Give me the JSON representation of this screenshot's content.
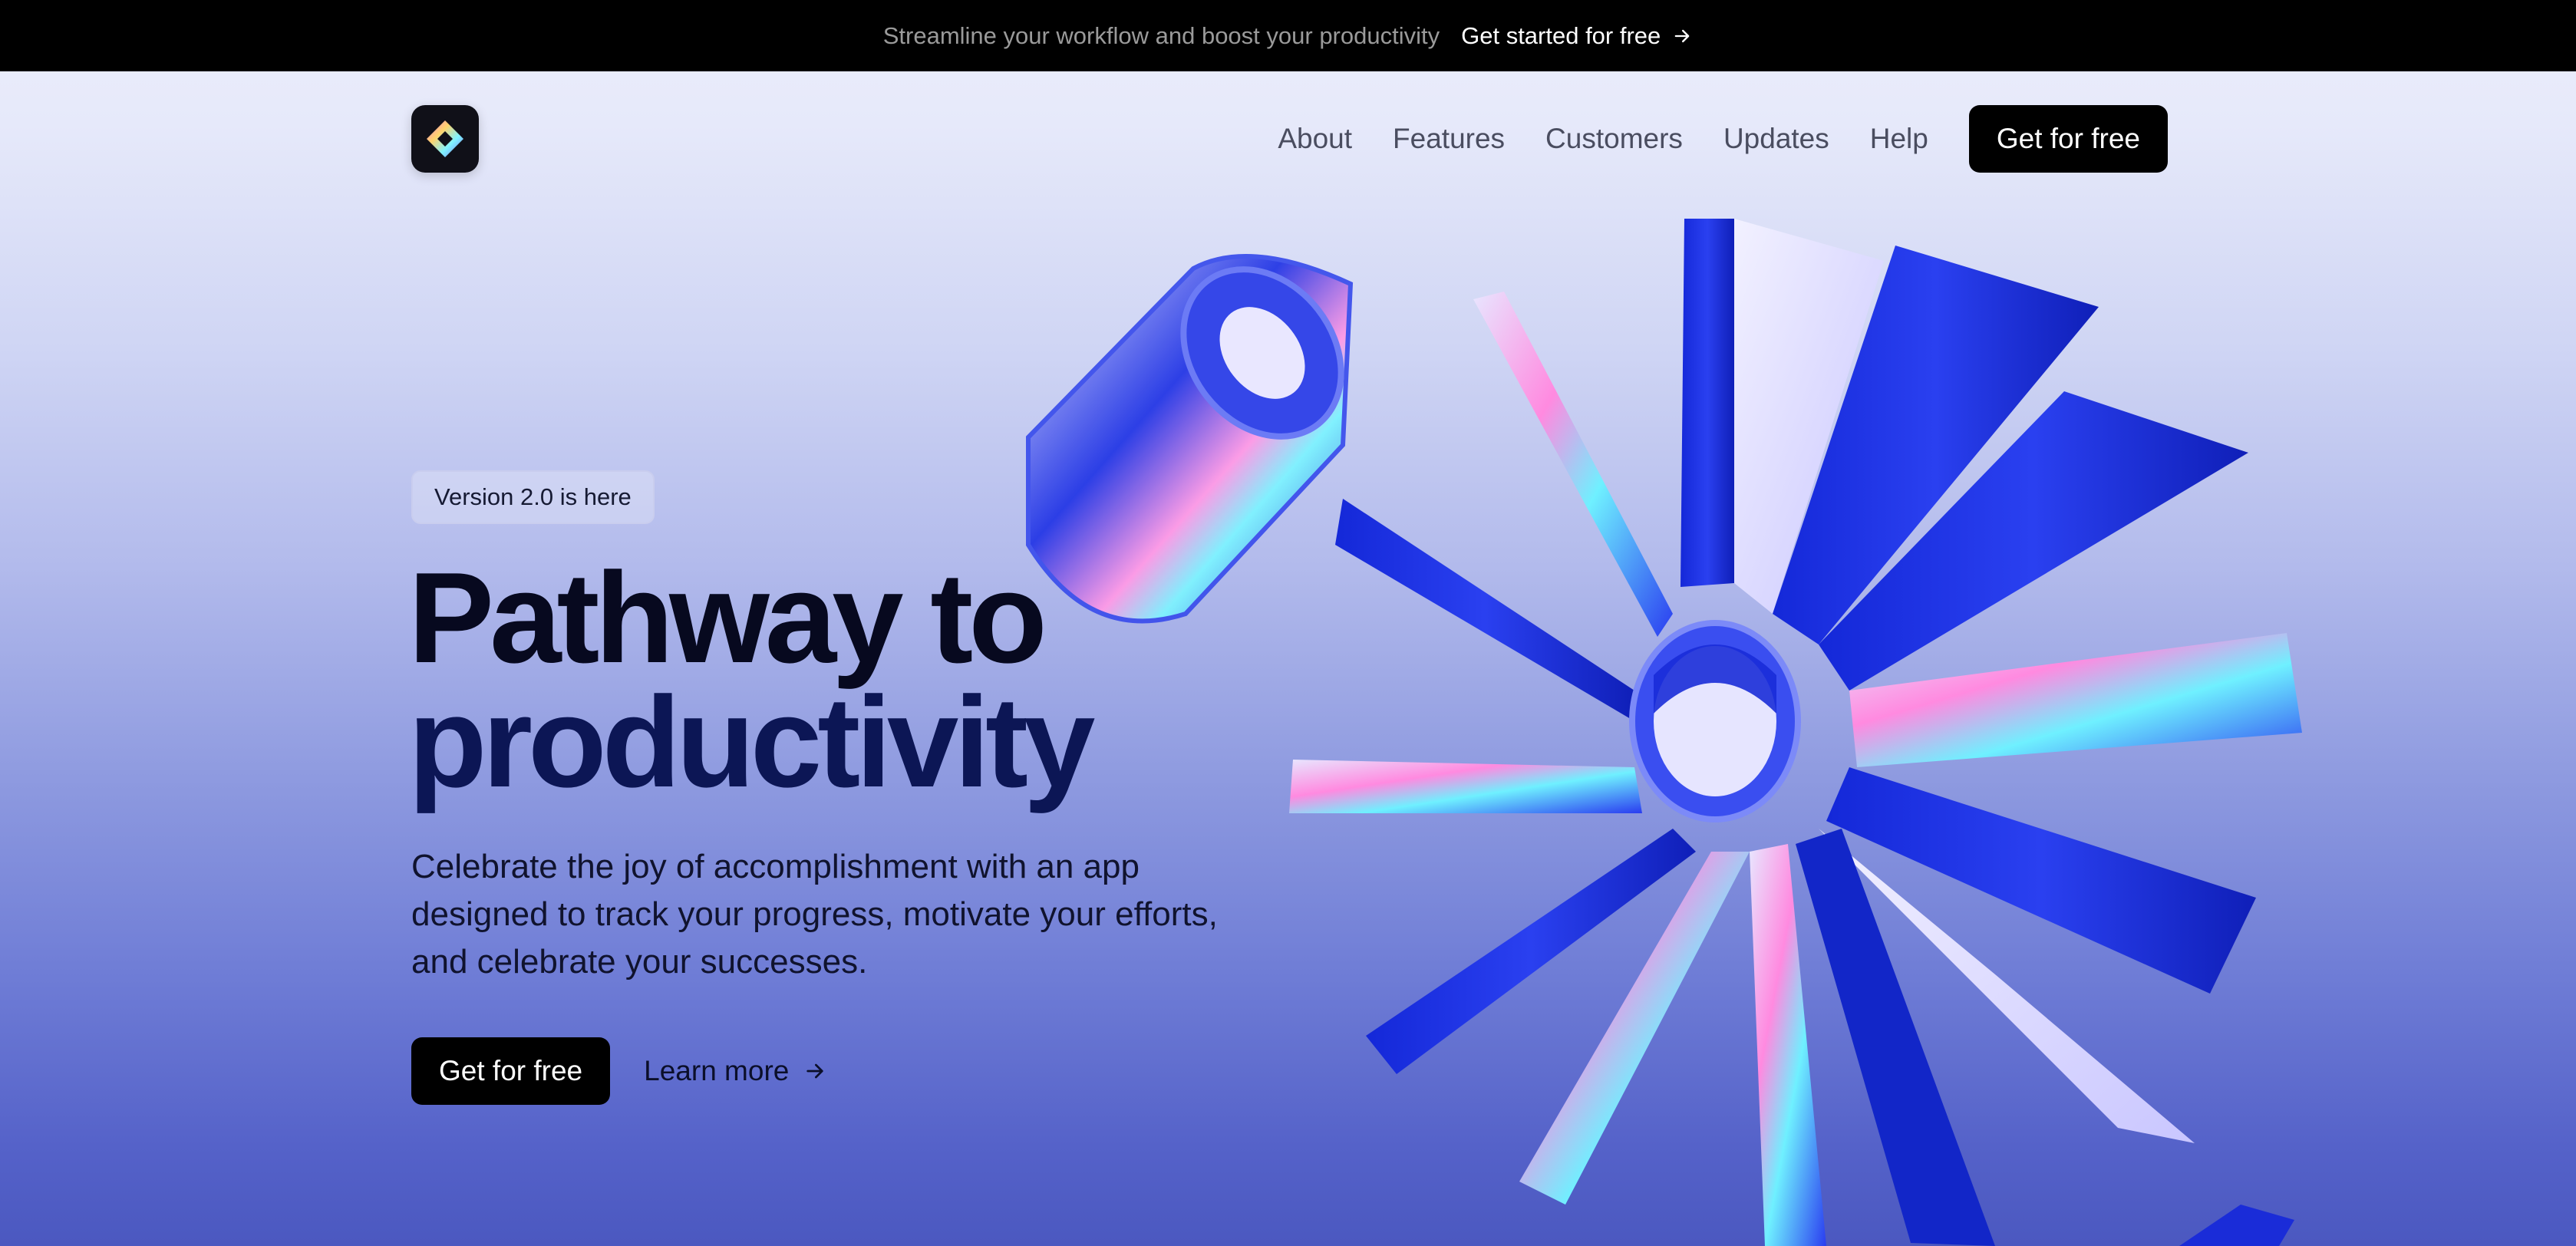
{
  "announcement": {
    "message": "Streamline your workflow and boost your productivity",
    "cta_label": "Get started for free"
  },
  "nav": {
    "logo_icon": "diamond-logo-icon",
    "links": [
      "About",
      "Features",
      "Customers",
      "Updates",
      "Help"
    ],
    "cta_label": "Get for free"
  },
  "hero": {
    "badge": "Version 2.0 is here",
    "headline_line1": "Pathway to",
    "headline_line2": "productivity",
    "subtitle": "Celebrate the joy of accomplishment with an app designed to track your progress, motivate your efforts, and celebrate your successes.",
    "primary_label": "Get for free",
    "secondary_label": "Learn more"
  },
  "colors": {
    "accent": "#1a2de0",
    "dark": "#000000",
    "headline": "#07091f"
  }
}
